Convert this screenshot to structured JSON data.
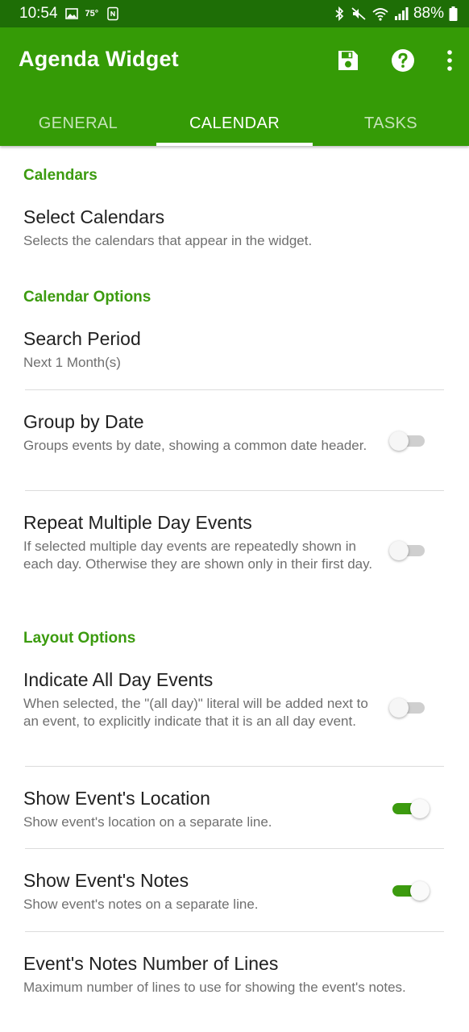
{
  "status_bar": {
    "time": "10:54",
    "temperature": "75°",
    "battery": "88%",
    "icons": [
      "image-icon",
      "weather-icon",
      "nfc-icon",
      "bluetooth-icon",
      "mute-icon",
      "wifi-icon",
      "signal-icon",
      "battery-icon"
    ]
  },
  "app_bar": {
    "title": "Agenda Widget",
    "actions": [
      "save-icon",
      "help-icon",
      "more-vert-icon"
    ]
  },
  "tabs": [
    {
      "label": "GENERAL",
      "active": false
    },
    {
      "label": "CALENDAR",
      "active": true
    },
    {
      "label": "TASKS",
      "active": false
    }
  ],
  "sections": {
    "calendars": {
      "header": "Calendars",
      "select_calendars": {
        "title": "Select Calendars",
        "summary": "Selects the calendars that appear in the widget."
      }
    },
    "calendar_options": {
      "header": "Calendar Options",
      "search_period": {
        "title": "Search Period",
        "summary": "Next 1 Month(s)"
      },
      "group_by_date": {
        "title": "Group by Date",
        "summary": "Groups events by date, showing a common date header.",
        "checked": false
      },
      "repeat_multiple": {
        "title": "Repeat Multiple Day Events",
        "summary": "If selected multiple day events are repeatedly shown in each day. Otherwise they are shown only in their first day.",
        "checked": false
      }
    },
    "layout_options": {
      "header": "Layout Options",
      "indicate_all_day": {
        "title": "Indicate All Day Events",
        "summary": "When selected, the \"(all day)\" literal will be added next to an event, to explicitly indicate that it is an all day event.",
        "checked": false
      },
      "show_location": {
        "title": "Show Event's Location",
        "summary": "Show event's location on a separate line.",
        "checked": true
      },
      "show_notes": {
        "title": "Show Event's Notes",
        "summary": "Show event's notes on a separate line.",
        "checked": true
      },
      "notes_lines": {
        "title": "Event's Notes Number of Lines",
        "summary": "Maximum number of lines to use for showing the event's notes."
      }
    }
  },
  "colors": {
    "status_bar": "#1e6e06",
    "app_bar": "#359b06",
    "accent": "#3c9b0f"
  }
}
